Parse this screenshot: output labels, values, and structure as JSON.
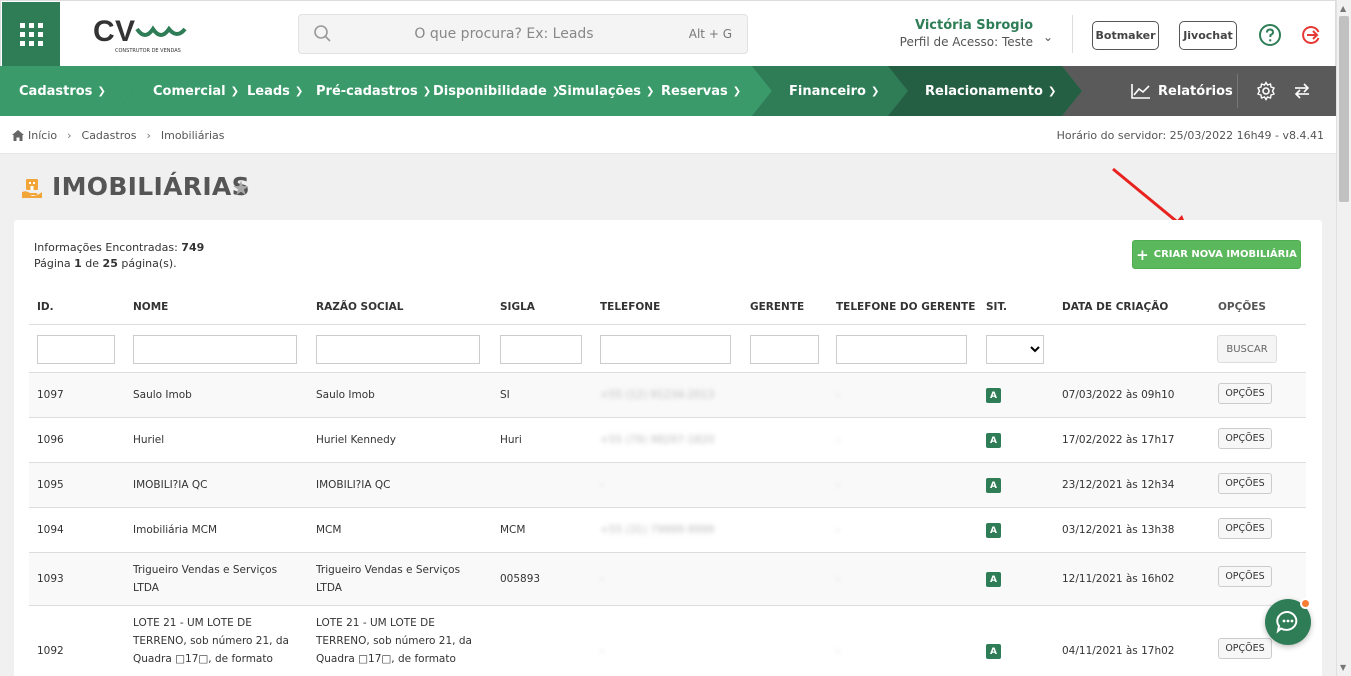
{
  "header": {
    "logo_text": "CV",
    "logo_tagline": "CONSTRUTOR DE VENDAS",
    "search_placeholder": "O que procura? Ex: Leads",
    "search_shortcut": "Alt + G",
    "user_name": "Victória Sbrogio",
    "user_profile": "Perfil de Acesso: Teste",
    "botmaker_label": "Botmaker",
    "jivochat_label": "Jivochat",
    "help_icon": "question-circle-icon",
    "logout_icon": "logout-icon",
    "accent_color": "#2e7d57",
    "logout_color": "#e53935"
  },
  "nav": {
    "items": [
      {
        "label": "Cadastros"
      },
      {
        "label": "Comercial"
      },
      {
        "label": "Leads"
      },
      {
        "label": "Pré-cadastros"
      },
      {
        "label": "Disponibilidade"
      },
      {
        "label": "Simulações"
      },
      {
        "label": "Reservas"
      },
      {
        "label": "Financeiro"
      },
      {
        "label": "Relacionamento"
      }
    ],
    "reports_label": "Relatórios",
    "settings_icon": "gear-icon",
    "swap_icon": "swap-arrows-icon"
  },
  "breadcrumb": {
    "items": [
      "Início",
      "Cadastros",
      "Imobiliárias"
    ],
    "server_time": "Horário do servidor: 25/03/2022 16h49 - v8.4.41"
  },
  "page": {
    "title": "IMOBILIÁRIAS",
    "info_label": "Informações Encontradas:",
    "info_count": "749",
    "page_label": "Página",
    "page_current": "1",
    "page_of": "de",
    "page_total": "25",
    "page_suffix": "página(s).",
    "create_button": "CRIAR NOVA IMOBILIÁRIA"
  },
  "table": {
    "columns": [
      "ID.",
      "NOME",
      "RAZÃO SOCIAL",
      "SIGLA",
      "TELEFONE",
      "GERENTE",
      "TELEFONE DO GERENTE",
      "SIT.",
      "DATA DE CRIAÇÃO",
      "OPÇÕES"
    ],
    "search_button": "BUSCAR",
    "options_label": "OPÇÕES",
    "rows": [
      {
        "id": "1097",
        "nome": "Saulo Imob",
        "razao": "Saulo Imob",
        "sigla": "SI",
        "telefone": "+55 (12) 91234-2013",
        "gerente": "",
        "tel_gerente": "-",
        "sit": "A",
        "data": "07/03/2022 às 09h10"
      },
      {
        "id": "1096",
        "nome": "Huriel",
        "razao": "Huriel Kennedy",
        "sigla": "Huri",
        "telefone": "+55 (79) 98297-1820",
        "gerente": "",
        "tel_gerente": "-",
        "sit": "A",
        "data": "17/02/2022 às 17h17"
      },
      {
        "id": "1095",
        "nome": "IMOBILI?IA QC",
        "razao": "IMOBILI?IA QC",
        "sigla": "",
        "telefone": "-",
        "gerente": "",
        "tel_gerente": "-",
        "sit": "A",
        "data": "23/12/2021 às 12h34"
      },
      {
        "id": "1094",
        "nome": "Imobiliária MCM",
        "razao": "MCM",
        "sigla": "MCM",
        "telefone": "+55 (31) 79999-9999",
        "gerente": "",
        "tel_gerente": "-",
        "sit": "A",
        "data": "03/12/2021 às 13h38"
      },
      {
        "id": "1093",
        "nome_l1": "Trigueiro Vendas e Serviços",
        "nome_l2": "LTDA",
        "razao_l1": "Trigueiro Vendas e Serviços",
        "razao_l2": "LTDA",
        "sigla": "005893",
        "telefone": "-",
        "gerente": "",
        "tel_gerente": "-",
        "sit": "A",
        "data": "12/11/2021 às 16h02"
      },
      {
        "id": "1092",
        "nome_l1": "LOTE 21 - UM LOTE DE",
        "nome_l2": "TERRENO, sob número 21, da",
        "nome_l3": "Quadra □17□, de formato",
        "razao_l1": "LOTE 21 - UM LOTE DE",
        "razao_l2": "TERRENO, sob número 21, da",
        "razao_l3": "Quadra □17□, de formato",
        "sigla": "",
        "telefone": "-",
        "gerente": "",
        "tel_gerente": "-",
        "sit": "A",
        "data": "04/11/2021 às 17h02"
      }
    ]
  },
  "chat": {
    "icon": "chat-bubble-icon",
    "notification_color": "#f57c33"
  }
}
